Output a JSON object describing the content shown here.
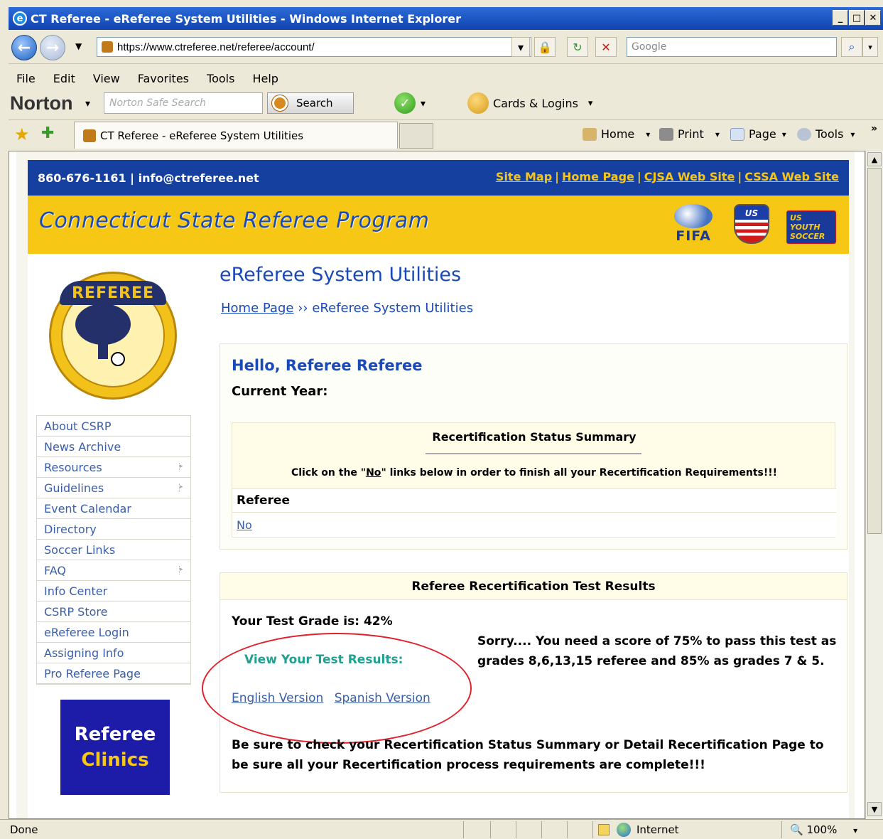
{
  "browser": {
    "title": "CT Referee - eReferee System Utilities - Windows Internet Explorer",
    "url": "https://www.ctreferee.net/referee/account/",
    "search_placeholder": "Google",
    "menu": [
      "File",
      "Edit",
      "View",
      "Favorites",
      "Tools",
      "Help"
    ],
    "norton": {
      "brand": "Norton",
      "search_placeholder": "Norton Safe Search",
      "search_label": "Search",
      "cards_label": "Cards & Logins"
    },
    "tab_title": "CT Referee - eReferee System Utilities",
    "commands": {
      "home": "Home",
      "print": "Print",
      "page": "Page",
      "tools": "Tools"
    },
    "status": {
      "done": "Done",
      "zone": "Internet",
      "zoom": "100%"
    }
  },
  "site": {
    "contact": "860-676-1161 | info@ctreferee.net",
    "top_links": [
      "Site Map",
      "Home Page",
      "CJSA Web Site",
      "CSSA Web Site"
    ],
    "banner_title": "Connecticut State Referee Program",
    "logos": {
      "fifa": "FIFA",
      "us": "US",
      "usys": "US YOUTH SOCCER"
    },
    "seal_text": "REFEREE",
    "sidenav": [
      {
        "label": "About CSRP",
        "submenu": false
      },
      {
        "label": "News Archive",
        "submenu": false
      },
      {
        "label": "Resources",
        "submenu": true
      },
      {
        "label": "Guidelines",
        "submenu": true
      },
      {
        "label": "Event Calendar",
        "submenu": false
      },
      {
        "label": "Directory",
        "submenu": false
      },
      {
        "label": "Soccer Links",
        "submenu": false
      },
      {
        "label": "FAQ",
        "submenu": true
      },
      {
        "label": "Info Center",
        "submenu": false
      },
      {
        "label": "CSRP Store",
        "submenu": false
      },
      {
        "label": "eReferee Login",
        "submenu": false
      },
      {
        "label": "Assigning Info",
        "submenu": false
      },
      {
        "label": "Pro Referee Page",
        "submenu": false
      }
    ],
    "clinics": {
      "line1": "Referee",
      "line2": "Clinics"
    }
  },
  "main": {
    "page_title": "eReferee System Utilities",
    "breadcrumb": {
      "home": "Home Page",
      "sep": "››",
      "current": "eReferee System Utilities"
    },
    "greeting": "Hello, Referee Referee",
    "current_year": "Current Year:",
    "recert": {
      "title": "Recertification Status Summary",
      "note_before": "Click on the \"",
      "note_link": "No",
      "note_after": "\" links below in order to finish all your Recertification Requirements!!!",
      "row_label": "Referee",
      "row_value": "No"
    },
    "test": {
      "header": "Referee Recertification Test Results",
      "grade": "Your Test Grade is: 42%",
      "view_results": "View Your Test Results:",
      "english": "English Version",
      "spanish": "Spanish Version",
      "sorry": "Sorry.... You need a score of 75% to pass this test as grades 8,6,13,15 referee and 85% as grades 7 & 5.",
      "reminder": "Be sure to check your Recertification Status Summary or Detail Recertification Page to be sure all your Recertification process requirements are complete!!!"
    }
  },
  "colors": {
    "top_bar": "#1640a0",
    "banner": "#f6c815",
    "link": "#3a5ea8",
    "heading": "#1a49b8",
    "annotation_circle": "#e0202a"
  }
}
